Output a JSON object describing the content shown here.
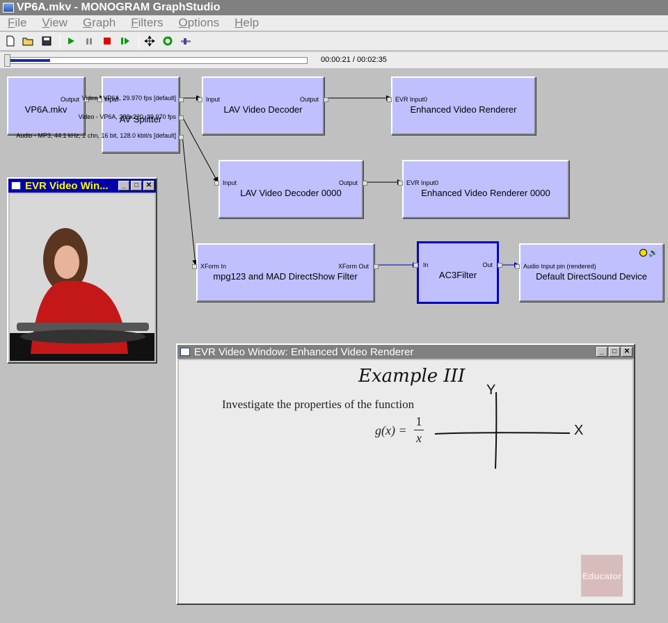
{
  "window": {
    "title": "VP6A.mkv - MONOGRAM GraphStudio"
  },
  "menu": [
    "File",
    "View",
    "Graph",
    "Filters",
    "Options",
    "Help"
  ],
  "toolbar": {
    "icons": [
      "new-icon",
      "open-icon",
      "save-icon",
      "play-icon",
      "pause-icon",
      "stop-icon",
      "step-icon",
      "arrange-icon",
      "refresh-icon",
      "seek-icon"
    ]
  },
  "seek": {
    "time": "00:00:21 / 00:02:35",
    "progress": 0.135
  },
  "filters": {
    "source": {
      "name": "VP6A.mkv",
      "out": "Output"
    },
    "splitter": {
      "name": "AV Splitter",
      "in": "Input",
      "pin1": "Video - VP6A, 29.970 fps [default]",
      "pin2": "Video - VP6A, 288x220, 29.970 fps",
      "pin3": "Audio - MP3, 44.1 kHz, 2 chn, 16 bit, 128.0 kbit/s [default]"
    },
    "lav1": {
      "name": "LAV Video Decoder",
      "in": "Input",
      "out": "Output"
    },
    "evr1": {
      "name": "Enhanced Video Renderer",
      "in": "EVR Input0"
    },
    "lav2": {
      "name": "LAV Video Decoder 0000",
      "in": "Input",
      "out": "Output"
    },
    "evr2": {
      "name": "Enhanced Video Renderer 0000",
      "in": "EVR Input0"
    },
    "mpg": {
      "name": "mpg123 and MAD DirectShow Filter",
      "in": "XForm In",
      "out": "XForm Out"
    },
    "ac3": {
      "name": "AC3Filter",
      "in": "In",
      "out": "Out"
    },
    "dsound": {
      "name": "Default DirectSound Device",
      "in": "Audio Input pin (rendered)"
    }
  },
  "video_small": {
    "title": "EVR Video Win..."
  },
  "video_big": {
    "title": "EVR Video Window: Enhanced Video Renderer",
    "heading": "Example III",
    "text": "Investigate the properties of the function",
    "fn_lhs": "g(x) =",
    "fn_num": "1",
    "fn_den": "x",
    "axis_y": "Y",
    "axis_x": "X",
    "logo": "Educator"
  }
}
